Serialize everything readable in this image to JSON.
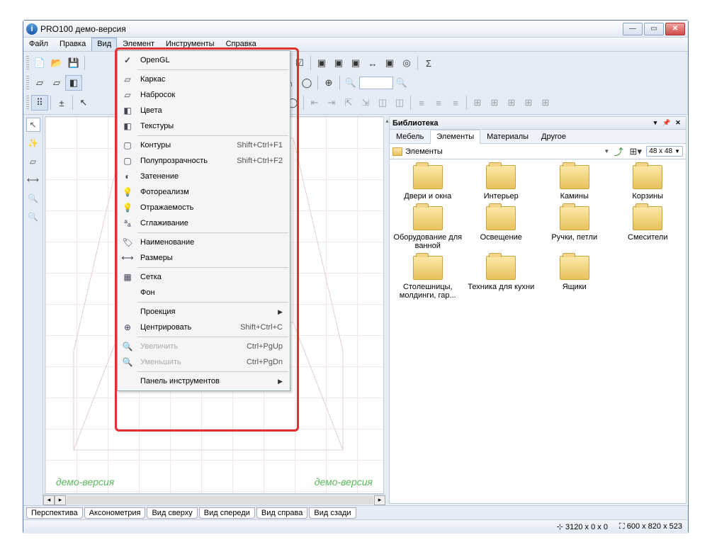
{
  "window": {
    "title": "PRO100 демо-версия"
  },
  "menubar": [
    "Файл",
    "Правка",
    "Вид",
    "Элемент",
    "Инструменты",
    "Справка"
  ],
  "menubar_open_index": 2,
  "dropdown": {
    "groups": [
      [
        {
          "icon": "check",
          "label": "OpenGL"
        }
      ],
      [
        {
          "icon": "wire-cube",
          "label": "Каркас"
        },
        {
          "icon": "wire-cube",
          "label": "Набросок"
        },
        {
          "icon": "solid-cube",
          "label": "Цвета"
        },
        {
          "icon": "solid-cube",
          "label": "Текстуры"
        }
      ],
      [
        {
          "icon": "cube",
          "label": "Контуры",
          "shortcut": "Shift+Ctrl+F1"
        },
        {
          "icon": "cube",
          "label": "Полупрозрачность",
          "shortcut": "Shift+Ctrl+F2"
        },
        {
          "icon": "shade",
          "label": "Затенение"
        },
        {
          "icon": "bulb",
          "label": "Фотореализм"
        },
        {
          "icon": "bulb",
          "label": "Отражаемость"
        },
        {
          "icon": "aa",
          "label": "Сглаживание"
        }
      ],
      [
        {
          "icon": "tag",
          "label": "Наименование"
        },
        {
          "icon": "dims",
          "label": "Размеры"
        }
      ],
      [
        {
          "icon": "grid",
          "label": "Сетка"
        },
        {
          "icon": "",
          "label": "Фон"
        }
      ],
      [
        {
          "icon": "",
          "label": "Проекция",
          "submenu": true
        },
        {
          "icon": "target",
          "label": "Центрировать",
          "shortcut": "Shift+Ctrl+C"
        }
      ],
      [
        {
          "icon": "zoom",
          "label": "Увеличить",
          "shortcut": "Ctrl+PgUp",
          "disabled": true
        },
        {
          "icon": "zoom",
          "label": "Уменьшить",
          "shortcut": "Ctrl+PgDn",
          "disabled": true
        }
      ],
      [
        {
          "icon": "",
          "label": "Панель инструментов",
          "submenu": true
        }
      ]
    ]
  },
  "library": {
    "title": "Библиотека",
    "tabs": [
      "Мебель",
      "Элементы",
      "Материалы",
      "Другое"
    ],
    "active_tab": 1,
    "path": "Элементы",
    "thumb_size": "48 x  48",
    "folders": [
      "Двери и окна",
      "Интерьер",
      "Камины",
      "Корзины",
      "Оборудование для ванной",
      "Освещение",
      "Ручки, петли",
      "Смесители",
      "Столешницы, молдинги, гар...",
      "Техника для кухни",
      "Ящики"
    ]
  },
  "watermark": "демо-версия",
  "viewtabs": [
    "Перспектива",
    "Аксонометрия",
    "Вид сверху",
    "Вид спереди",
    "Вид справа",
    "Вид сзади"
  ],
  "status": {
    "pos": "3120 x 0 x 0",
    "size": "600 x 820 x 523"
  }
}
